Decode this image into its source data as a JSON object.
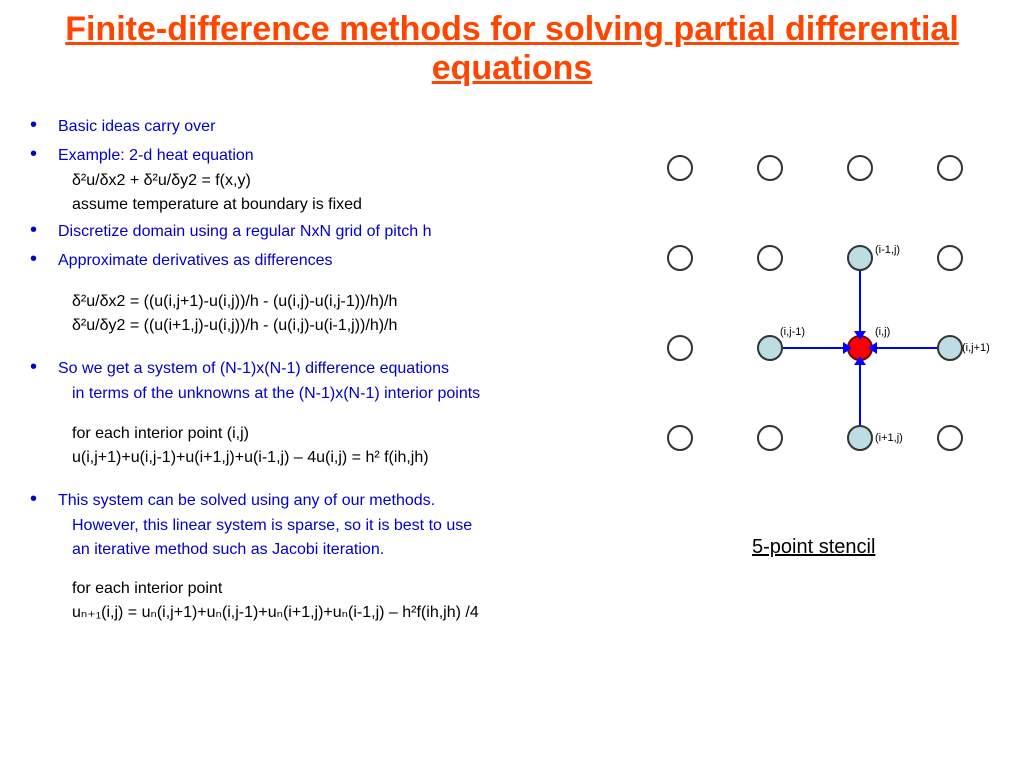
{
  "title": "Finite-difference methods for solving partial differential equations",
  "bullets": {
    "b1": "Basic ideas carry over",
    "b2": "Example: 2-d heat equation",
    "b2s1": "δ²u/δx2 + δ²u/δy2 = f(x,y)",
    "b2s2": "assume temperature at boundary is fixed",
    "b3": "Discretize domain using a regular NxN grid of pitch h",
    "b4": "Approximate derivatives as differences",
    "b4s1": "δ²u/δx2 =  ((u(i,j+1)-u(i,j))/h  - (u(i,j)-u(i,j-1))/h)/h",
    "b4s2": "δ²u/δy2 =  ((u(i+1,j)-u(i,j))/h  - (u(i,j)-u(i-1,j))/h)/h",
    "b5": "So we get a system of (N-1)x(N-1) difference equations",
    "b5a": "in terms of the unknowns at the (N-1)x(N-1) interior points",
    "b5s1": "for each interior point (i,j)",
    "b5s2": "u(i,j+1)+u(i,j-1)+u(i+1,j)+u(i-1,j) – 4u(i,j) = h² f(ih,jh)",
    "b6": "This system can be solved using any of our methods.",
    "b6a": "However, this linear system is sparse, so it is best to use",
    "b6b": "an iterative method such as Jacobi iteration.",
    "b6s1": "for each interior point",
    "b6s2": "uₙ₊₁(i,j) = uₙ(i,j+1)+uₙ(i,j-1)+uₙ(i+1,j)+uₙ(i-1,j) – h²f(ih,jh) /4"
  },
  "stencil": {
    "caption": "5-point stencil",
    "labels": {
      "top": "(i-1,j)",
      "center": "(i,j)",
      "left": "(i,j-1)",
      "right": "(i,j+1)",
      "bottom": "(i+1,j)"
    }
  }
}
